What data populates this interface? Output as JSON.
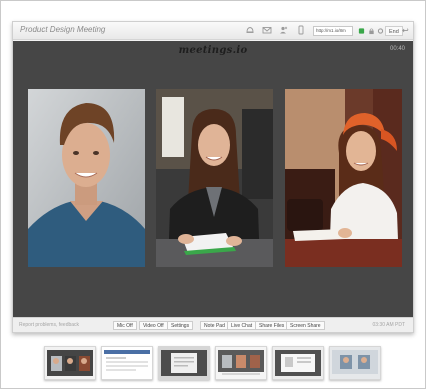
{
  "window": {
    "title": "Product Design Meeting",
    "url": "http://m1.io/8m",
    "end_label": "End",
    "toolbar_icons": [
      "bell-icon",
      "mail-icon",
      "people-icon",
      "phone-icon"
    ],
    "status_icons": [
      "record-icon",
      "lock-icon",
      "settings-icon"
    ]
  },
  "stage": {
    "logo": "meetings.io",
    "timer": "00:40"
  },
  "participants": [
    {
      "name": "participant-man"
    },
    {
      "name": "participant-woman-desk"
    },
    {
      "name": "participant-woman-headscarf"
    }
  ],
  "bottom_bar": {
    "report": "Report problems, feedback",
    "buttons": {
      "mic": "Mic Off",
      "video": "Video Off",
      "settings": "Settings",
      "notepad": "Note Pad",
      "livechat": "Live Chat",
      "sharefiles": "Share Files",
      "screenshare": "Screen Share"
    },
    "time": "03:30 AM PDT"
  },
  "thumbnails": [
    {
      "name": "video-call-view"
    },
    {
      "name": "meeting-list-view"
    },
    {
      "name": "notes-view"
    },
    {
      "name": "chat-view"
    },
    {
      "name": "files-view"
    },
    {
      "name": "screen-share-view"
    }
  ],
  "colors": {
    "stage_bg": "#464646",
    "toolbar_bg": "#efefef",
    "accent_green": "#3aa74a"
  }
}
